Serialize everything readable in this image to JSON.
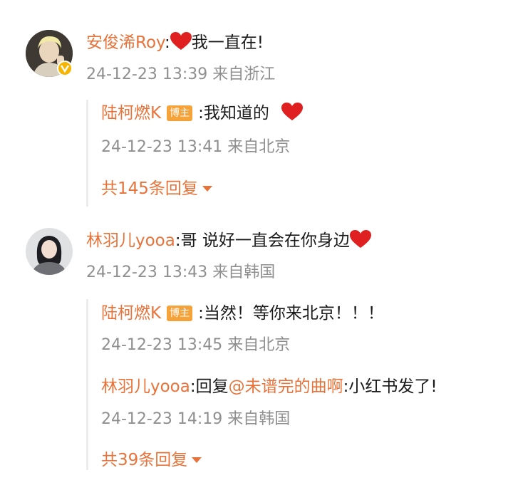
{
  "comments": [
    {
      "user": "安俊浠Roy",
      "separator": ":",
      "text": "我一直在!",
      "meta": "24-12-23 13:39 来自浙江",
      "avatar_icon": "user-avatar-blonde",
      "verified": true,
      "replies": [
        {
          "user": "陆柯燃K",
          "badge": "博主",
          "separator": ":",
          "text": "我知道的",
          "meta": "24-12-23 13:41 来自北京"
        }
      ],
      "more_label": "共145条回复"
    },
    {
      "user": "林羽儿yooa",
      "separator": ":",
      "text": "哥 说好一直会在你身边",
      "meta": "24-12-23 13:43 来自韩国",
      "avatar_icon": "user-avatar-girl",
      "verified": false,
      "replies": [
        {
          "user": "陆柯燃K",
          "badge": "博主",
          "separator": ":",
          "text": "当然！等你来北京！！！",
          "meta": "24-12-23 13:45 来自北京"
        },
        {
          "user": "林羽儿yooa",
          "separator": ":",
          "reply_word": "回复",
          "mention": "@未谱完的曲啊",
          "separator2": ":",
          "text": "小红书发了!",
          "meta": "24-12-23 14:19 来自韩国"
        }
      ],
      "more_label": "共39条回复"
    }
  ],
  "colors": {
    "name": "#e8733a",
    "meta": "#8f8f8f",
    "badge": "#f6a23a",
    "heart": "#e02020"
  },
  "icons": [
    "heart-icon",
    "verified-badge-icon",
    "caret-down-icon"
  ]
}
